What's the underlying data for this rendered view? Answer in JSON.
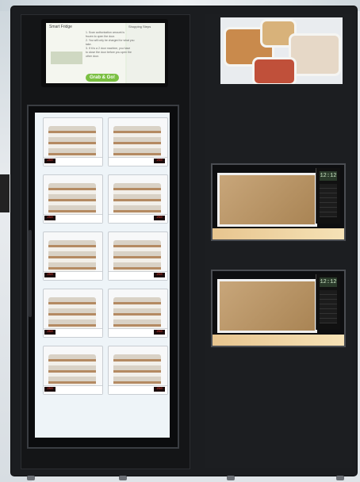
{
  "scene": "vending-machine",
  "touch_screen": {
    "title": "Smart Fridge",
    "heading": "Shopping Steps",
    "steps": [
      "1. Scan authorization amount is",
      "frozen to open the door.",
      "2. You will only be charged for what you",
      "take.",
      "3. If it is a 2 door machine, you have",
      "to close the door before you open the",
      "other door."
    ],
    "button_label": "Grab & Go!"
  },
  "price_tag_label": "250",
  "microwave_clock": [
    "12:12",
    "12:12"
  ],
  "colors": {
    "cabinet": "#1b1d20",
    "accent_green": "#7bc043",
    "price_red": "#ff3b30"
  }
}
